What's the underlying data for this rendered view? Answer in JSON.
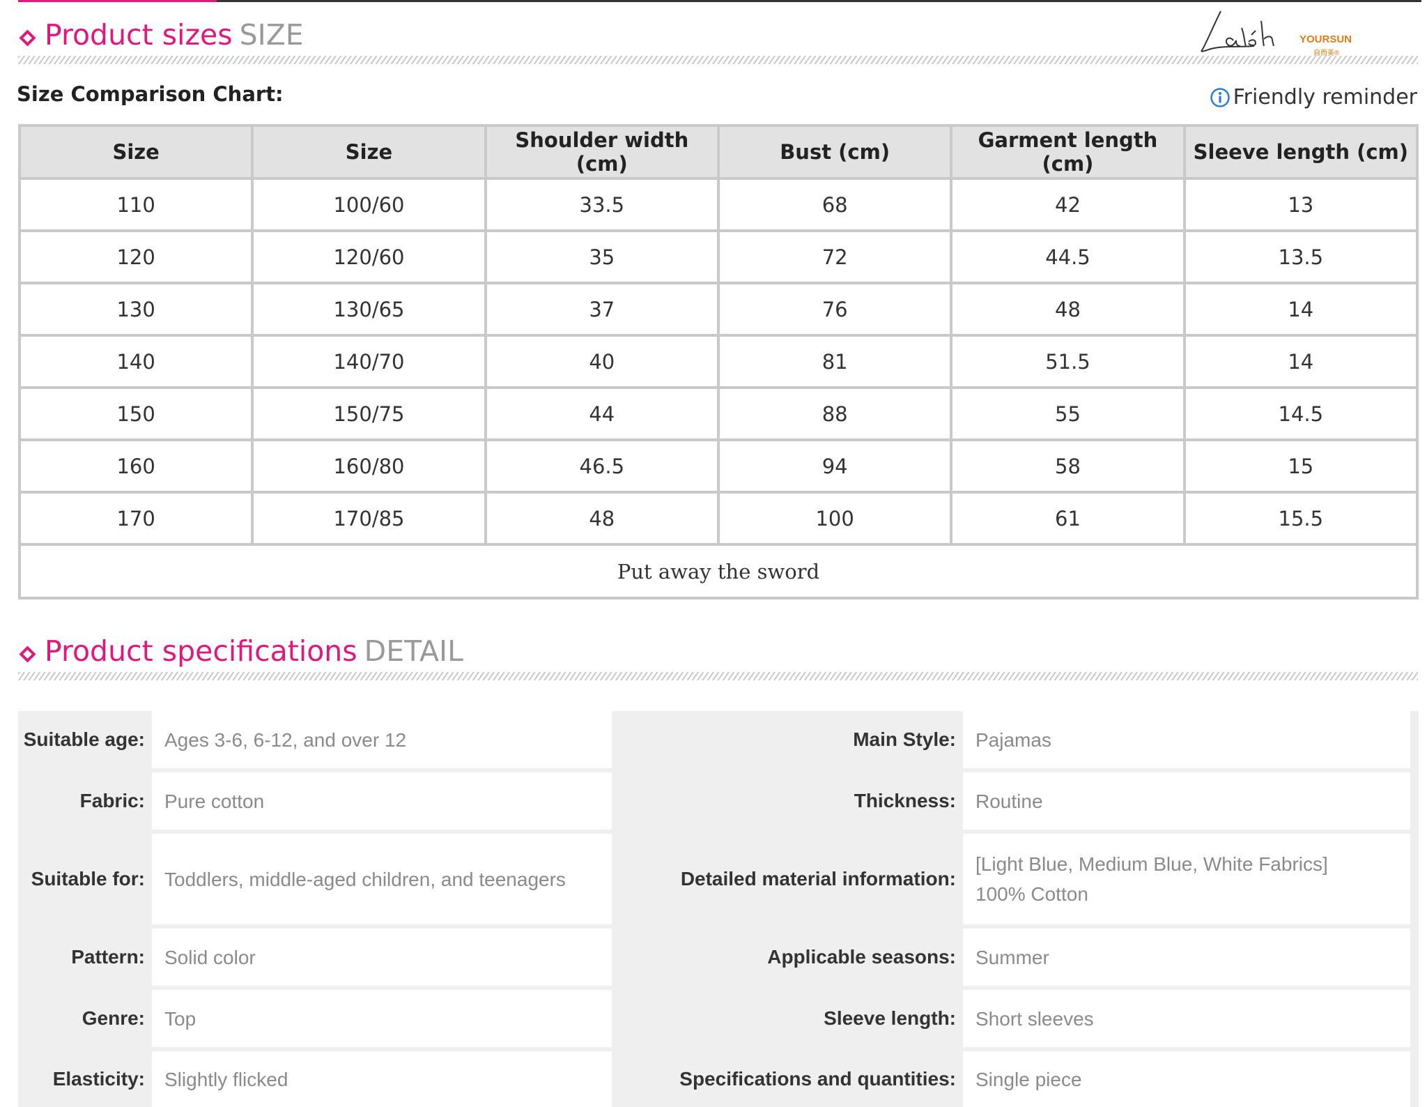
{
  "size_section": {
    "title_cn": "Product sizes",
    "title_en": "SIZE",
    "chart_label": "Size Comparison Chart:",
    "reminder": "Friendly reminder",
    "headers": [
      "Size",
      "Size",
      "Shoulder width (cm)",
      "Bust (cm)",
      "Garment length (cm)",
      "Sleeve length (cm)"
    ],
    "rows": [
      [
        "110",
        "100/60",
        "33.5",
        "68",
        "42",
        "13"
      ],
      [
        "120",
        "120/60",
        "35",
        "72",
        "44.5",
        "13.5"
      ],
      [
        "130",
        "130/65",
        "37",
        "76",
        "48",
        "14"
      ],
      [
        "140",
        "140/70",
        "40",
        "81",
        "51.5",
        "14"
      ],
      [
        "150",
        "150/75",
        "44",
        "88",
        "55",
        "14.5"
      ],
      [
        "160",
        "160/80",
        "46.5",
        "94",
        "58",
        "15"
      ],
      [
        "170",
        "170/85",
        "48",
        "100",
        "61",
        "15.5"
      ]
    ],
    "footnote": "Put away  the  sword"
  },
  "logo": {
    "script": "Laléh",
    "brand": "YOURSUN",
    "brand_sub": "自而美®"
  },
  "spec_section": {
    "title_cn": "Product specifications",
    "title_en": "DETAIL",
    "rows": [
      {
        "label1": "Suitable age:",
        "value1": "Ages 3-6, 6-12, and over 12",
        "label2": "Main Style:",
        "value2": "Pajamas"
      },
      {
        "label1": "Fabric:",
        "value1": "Pure cotton",
        "label2": "Thickness:",
        "value2": "Routine"
      },
      {
        "label1": "Suitable for:",
        "value1": "Toddlers, middle-aged children, and teenagers",
        "label2": "Detailed material information:",
        "value2": "[Light Blue, Medium Blue, White Fabrics] 100% Cotton"
      },
      {
        "label1": "Pattern:",
        "value1": "Solid color",
        "label2": "Applicable seasons:",
        "value2": "Summer"
      },
      {
        "label1": "Genre:",
        "value1": "Top",
        "label2": "Sleeve length:",
        "value2": "Short sleeves"
      },
      {
        "label1": "Elasticity:",
        "value1": "Slightly flicked",
        "label2": "Specifications and quantities:",
        "value2": "Single piece"
      }
    ]
  },
  "colors": {
    "accent": "#e0177d",
    "header_bg": "#e2e2e2",
    "border": "#c9c9c9",
    "info_icon": "#2a7fd4",
    "logo_orange": "#e07b1a"
  }
}
